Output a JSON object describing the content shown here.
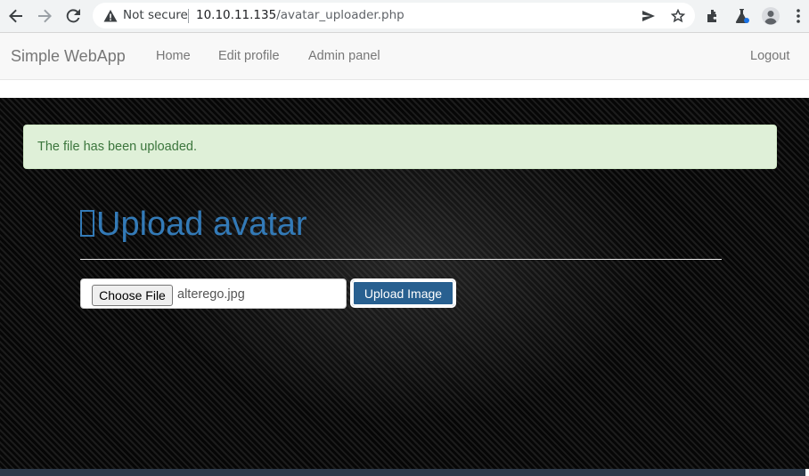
{
  "browser": {
    "security_label": "Not secure",
    "url_host": "10.10.11.135",
    "url_path": "/avatar_uploader.php"
  },
  "navbar": {
    "brand": "Simple WebApp",
    "links": [
      {
        "label": "Home"
      },
      {
        "label": "Edit profile"
      },
      {
        "label": "Admin panel"
      }
    ],
    "logout": "Logout"
  },
  "alert": {
    "message": "The file has been uploaded.",
    "color": "#3c763d",
    "background": "#dff0d8"
  },
  "main": {
    "heading": "Upload avatar",
    "heading_icon": "upload-icon",
    "file_button": "Choose File",
    "file_name": "alterego.jpg",
    "submit_label": "Upload Image",
    "accent_color": "#337ab7"
  }
}
